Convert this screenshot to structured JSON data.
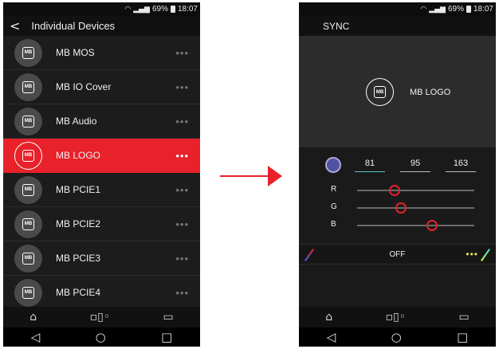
{
  "left_phone": {
    "status": {
      "wifi": "wifi-icon",
      "signal": "signal-icon",
      "battery_pct": "69%",
      "time": "18:07"
    },
    "header": {
      "back_glyph": "<",
      "title": "Individual Devices"
    },
    "devices": [
      {
        "name": "MB MOS",
        "badge": "MB"
      },
      {
        "name": "MB IO Cover",
        "badge": "MB"
      },
      {
        "name": "MB Audio",
        "badge": "MB"
      },
      {
        "name": "MB LOGO",
        "badge": "MB",
        "selected": true
      },
      {
        "name": "MB PCIE1",
        "badge": "MB"
      },
      {
        "name": "MB PCIE2",
        "badge": "MB"
      },
      {
        "name": "MB PCIE3",
        "badge": "MB"
      },
      {
        "name": "MB PCIE4",
        "badge": "MB"
      }
    ],
    "row_menu_glyph": "•••"
  },
  "right_phone": {
    "status": {
      "wifi": "wifi-icon",
      "signal": "signal-icon",
      "battery_pct": "69%",
      "time": "18:07"
    },
    "header": {
      "title": "SYNC"
    },
    "preview": {
      "badge": "MB",
      "name": "MB LOGO"
    },
    "color": {
      "swatch_hex": "#5151a3",
      "r": "81",
      "g": "95",
      "b": "163"
    },
    "sliders": [
      {
        "label": "R",
        "value": 81
      },
      {
        "label": "G",
        "value": 95
      },
      {
        "label": "B",
        "value": 163
      }
    ],
    "effect": {
      "label": "OFF",
      "more_glyph": "•••"
    }
  },
  "nav": {
    "home": "home-icon",
    "devices": "devices-icon",
    "tablet": "tablet-icon"
  },
  "android": {
    "back": "◁",
    "home": "○",
    "recent": "□"
  },
  "accent": "#e8212a"
}
